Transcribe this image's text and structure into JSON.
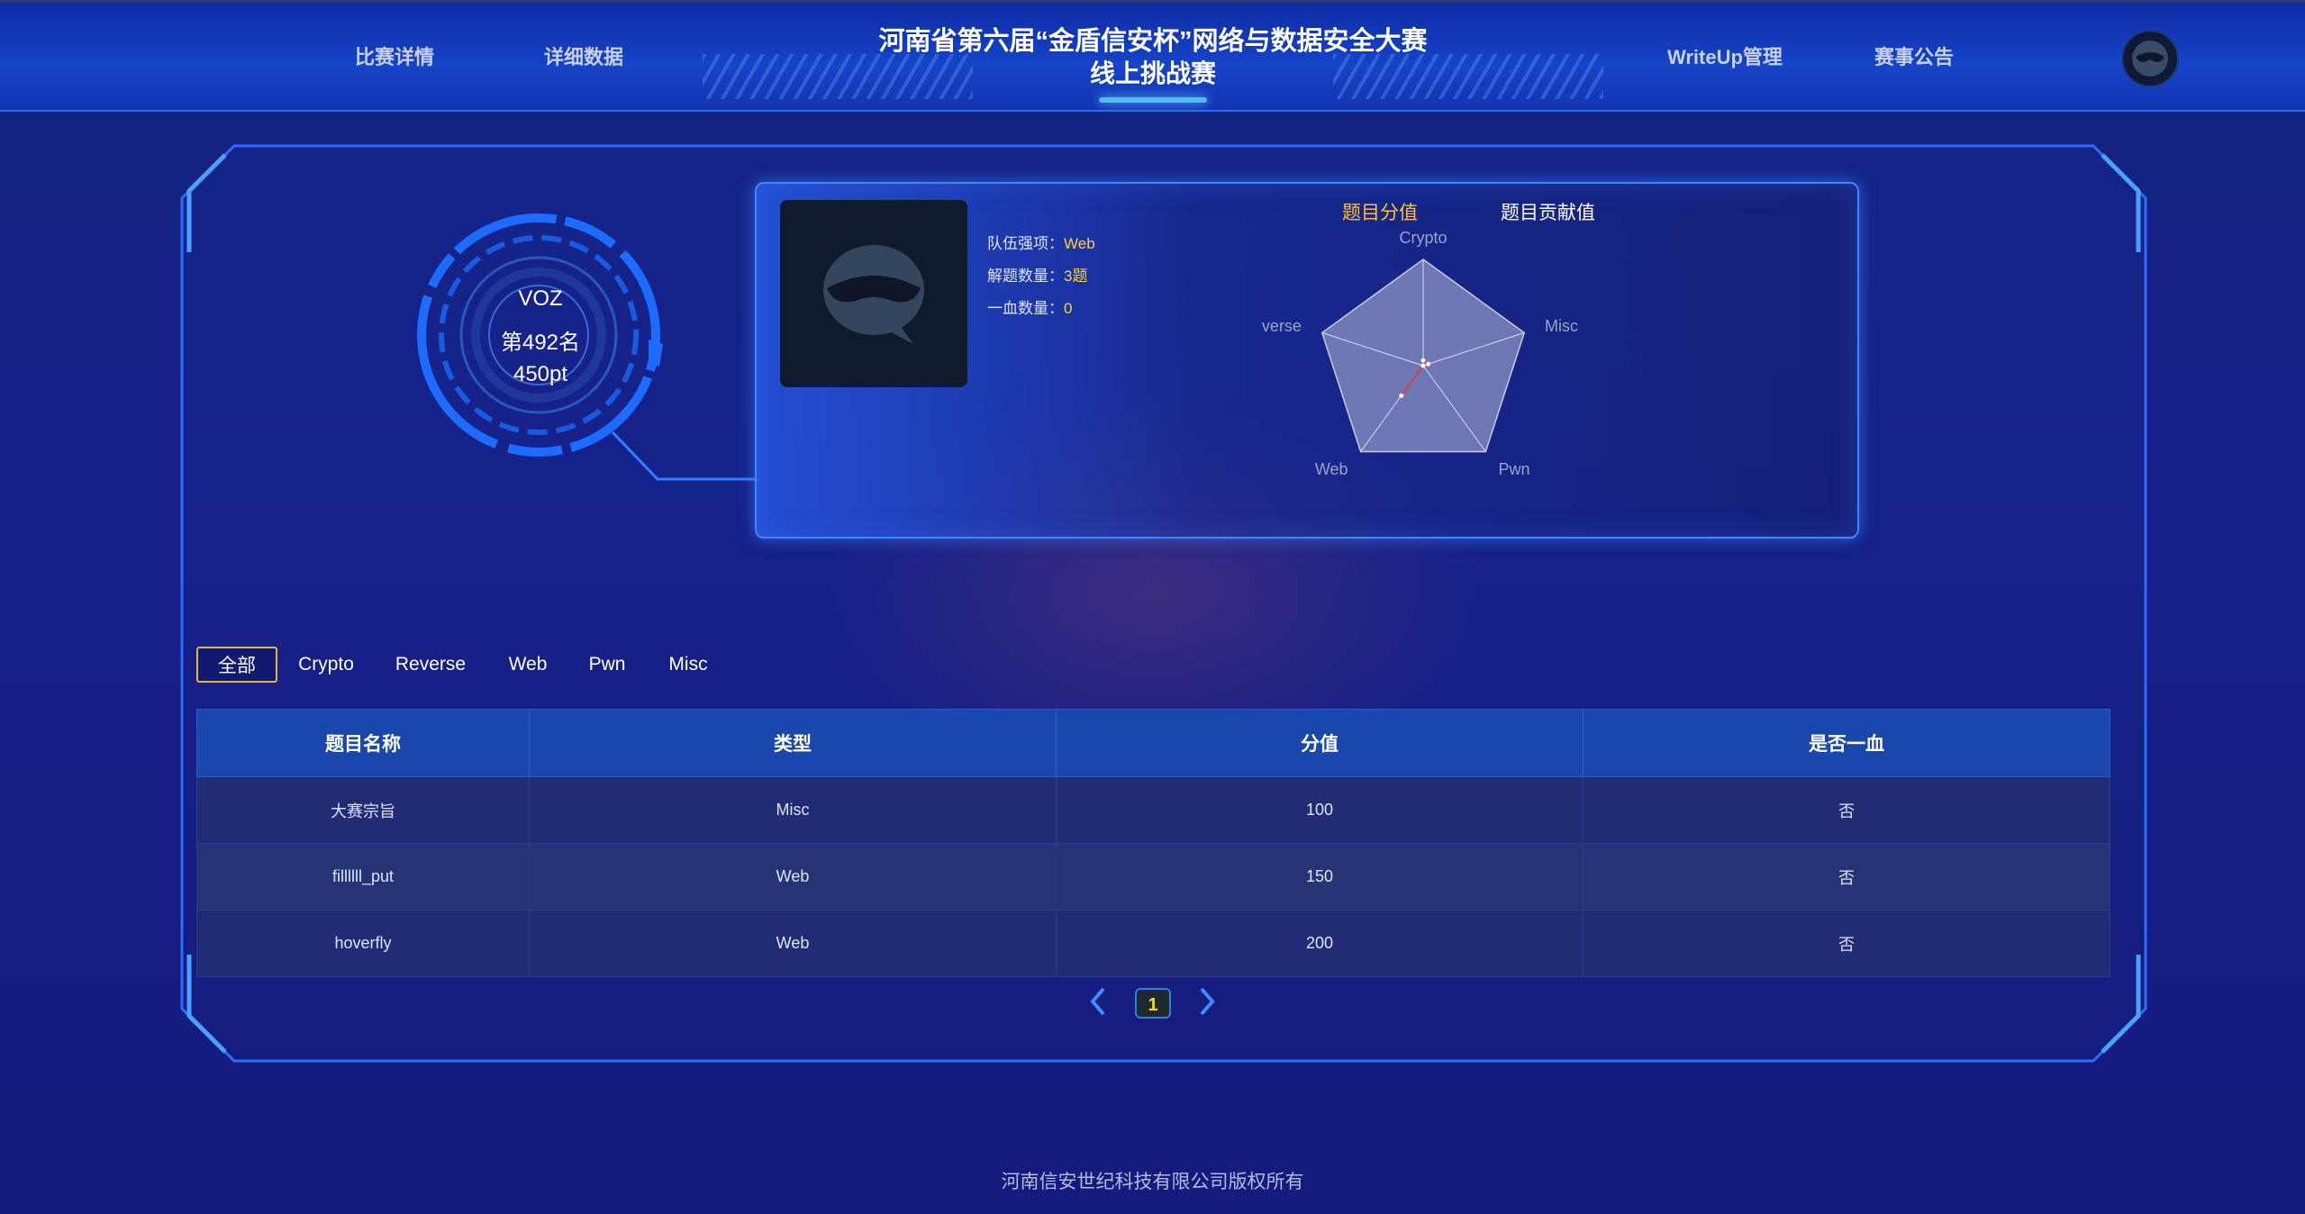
{
  "header": {
    "nav_left": [
      "比赛详情",
      "详细数据"
    ],
    "nav_right": [
      "WriteUp管理",
      "赛事公告"
    ],
    "title_line1": "河南省第六届“金盾信安杯”网络与数据安全大赛",
    "title_line2": "线上挑战赛"
  },
  "team": {
    "name": "VOZ",
    "rank": "第492名",
    "points": "450pt",
    "strong_label": "队伍强项：",
    "strong_value": "Web",
    "solved_label": "解题数量：",
    "solved_value": "3题",
    "blood_label": "一血数量：",
    "blood_value": "0"
  },
  "radar": {
    "tabs": [
      "题目分值",
      "题目贡献值"
    ],
    "active_tab": "题目分值",
    "axes": [
      "Crypto",
      "Misc",
      "Pwn",
      "Web",
      "Reverse"
    ],
    "values": [
      0.05,
      0.05,
      0.0,
      0.35,
      0.0
    ],
    "accent": "#ffc233"
  },
  "categories": [
    "全部",
    "Crypto",
    "Reverse",
    "Web",
    "Pwn",
    "Misc"
  ],
  "active_category": "全部",
  "table": {
    "headers": [
      "题目名称",
      "类型",
      "分值",
      "是否一血"
    ],
    "rows": [
      [
        "大赛宗旨",
        "Misc",
        "100",
        "否"
      ],
      [
        "fillllll_put",
        "Web",
        "150",
        "否"
      ],
      [
        "hoverfly",
        "Web",
        "200",
        "否"
      ]
    ]
  },
  "pagination": {
    "current": "1"
  },
  "footer": "河南信安世纪科技有限公司版权所有"
}
